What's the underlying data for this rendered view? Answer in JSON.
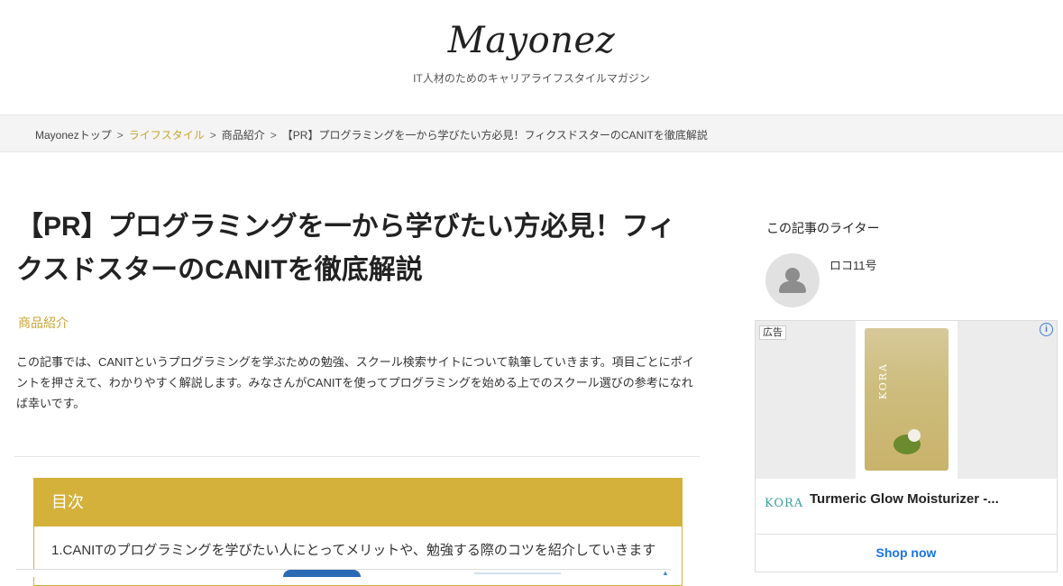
{
  "site": {
    "logo": "Mayonez",
    "tagline": "IT人材のためのキャリアライフスタイルマガジン"
  },
  "breadcrumb": {
    "separator": ">",
    "items": [
      "Mayonezトップ",
      "ライフスタイル",
      "商品紹介",
      "【PR】プログラミングを一から学びたい方必見！フィクスドスターのCANITを徹底解説"
    ]
  },
  "article": {
    "title": "【PR】プログラミングを一から学びたい方必見！フィクスドスターのCANITを徹底解説",
    "category": "商品紹介",
    "intro": "この記事では、CANITというプログラミングを学ぶための勉強、スクール検索サイトについて執筆していきます。項目ごとにポイントを押さえて、わかりやすく解説します。みなさんがCANITを使ってプログラミングを始める上でのスクール選びの参考になれば幸いです。"
  },
  "toc": {
    "heading": "目次",
    "items": [
      "1.CANITのプログラミングを学びたい人にとってメリットや、勉強する際のコツを紹介していきます"
    ]
  },
  "sidebar": {
    "writer_heading": "この記事のライター",
    "writer_name": "ロコ11号"
  },
  "ad": {
    "label": "広告",
    "info_icon": "info-icon",
    "brand_mark": "KORA",
    "title": "Turmeric Glow Moisturizer -...",
    "cta": "Shop now"
  },
  "colors": {
    "accent_gold": "#d4b13a",
    "link_gold": "#c9a431",
    "ad_link_blue": "#1a73e8"
  }
}
